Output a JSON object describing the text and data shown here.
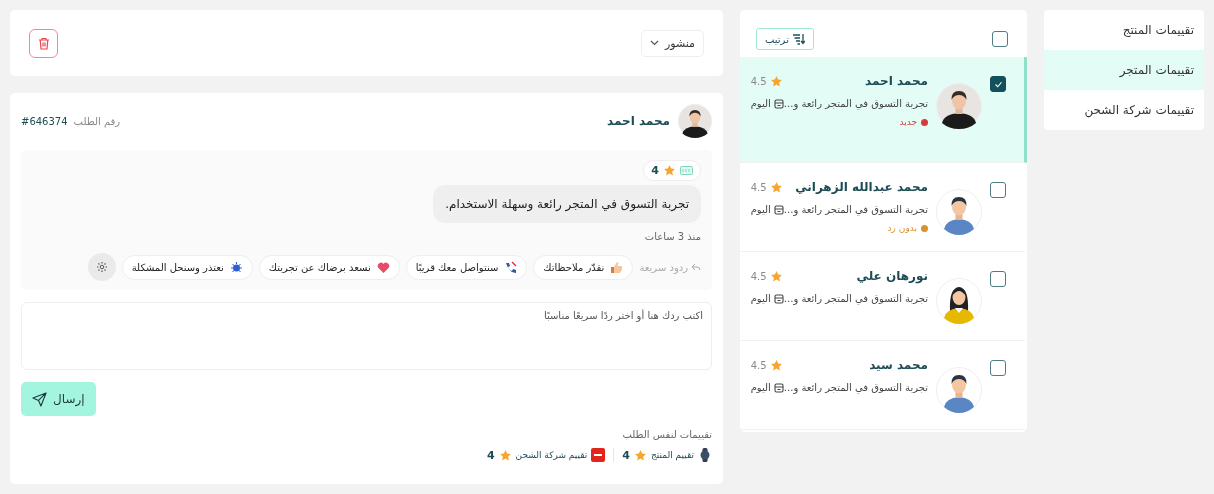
{
  "sidebar": {
    "items": [
      {
        "label": "تقييمات المنتج",
        "selected": false
      },
      {
        "label": "تقييمات المتجر",
        "selected": true
      },
      {
        "label": "تقييمات شركة الشحن",
        "selected": false
      }
    ]
  },
  "list": {
    "select_all_checked": false,
    "sort_button": "ترتيب",
    "items": [
      {
        "name": "محمد احمد",
        "rating": "4.5",
        "snippet": "تجربة التسوق في المتجر رائعة و...",
        "date": "اليوم",
        "selected": true,
        "checked": true,
        "avatar": {
          "kind": "photo"
        },
        "status": {
          "label": "جديد",
          "color": "#d63b3b"
        }
      },
      {
        "name": "محمد عبدالله الزهراني",
        "rating": "4.5",
        "snippet": "تجربة التسوق في المتجر رائعة و...",
        "date": "اليوم",
        "selected": false,
        "checked": false,
        "avatar": {
          "kind": "man"
        },
        "status": {
          "label": "بدون رد",
          "color": "#d9912e"
        }
      },
      {
        "name": "نورهان علي",
        "rating": "4.5",
        "snippet": "تجربة التسوق في المتجر رائعة و...",
        "date": "اليوم",
        "selected": false,
        "checked": false,
        "avatar": {
          "kind": "woman"
        }
      },
      {
        "name": "محمد سيد",
        "rating": "4.5",
        "snippet": "تجربة التسوق في المتجر رائعة و...",
        "date": "اليوم",
        "selected": false,
        "checked": false,
        "avatar": {
          "kind": "man"
        }
      }
    ]
  },
  "toolbar": {
    "status_dropdown": "منشور"
  },
  "detail": {
    "customer_name": "محمد احمد",
    "order_label": "رقم الطلب",
    "order_number": "#646374",
    "rating": "4",
    "message": "تجربة التسوق في المتجر رائعة وسهلة الاستخدام.",
    "time": "منذ 3 ساعات",
    "quick_replies_label": "ردود سريعة",
    "quick_replies": [
      {
        "label": "نقدّر ملاحظاتك",
        "kind": "thumb"
      },
      {
        "label": "سنتواصل معك قريبًا",
        "kind": "phone"
      },
      {
        "label": "نسعد برضاك عن تجربتك",
        "kind": "heart"
      },
      {
        "label": "نعتذر وسنحل المشكلة",
        "kind": "bug"
      }
    ],
    "reply_placeholder": "اكتب ردك هنا أو اختر ردًا سريعًا مناسبًا",
    "send_button": "إرسال",
    "related_title": "تقييمات لنفس الطلب",
    "related": [
      {
        "label": "تقييم المنتج",
        "rating": "4",
        "kind": "product"
      },
      {
        "label": "تقييم شركة الشحن",
        "rating": "4",
        "kind": "shipping"
      }
    ]
  }
}
